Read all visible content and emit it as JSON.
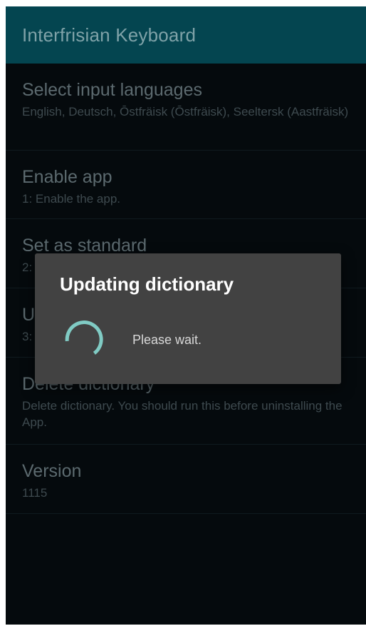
{
  "app_bar": {
    "title": "Interfrisian Keyboard"
  },
  "preferences": [
    {
      "title": "Select input languages",
      "summary": "English, Deutsch, Ōstfräisk (Ōstfräisk), Seeltersk (Aastfräisk)"
    },
    {
      "title": "Enable app",
      "summary": "1: Enable the app."
    },
    {
      "title": "Set as standard",
      "summary": "2:"
    },
    {
      "title": "U",
      "summary": "3:"
    },
    {
      "title": "Delete dictionary",
      "summary": "Delete dictionary. You should run this before uninstalling the App."
    },
    {
      "title": "Version",
      "summary": "1115"
    }
  ],
  "dialog": {
    "title": "Updating dictionary",
    "message": "Please wait.",
    "spinner_icon": "progress-spinner-icon",
    "spinner_color": "#80cbc4"
  },
  "colors": {
    "app_bar": "#044550",
    "background": "#050a0d",
    "dialog": "#424242"
  }
}
